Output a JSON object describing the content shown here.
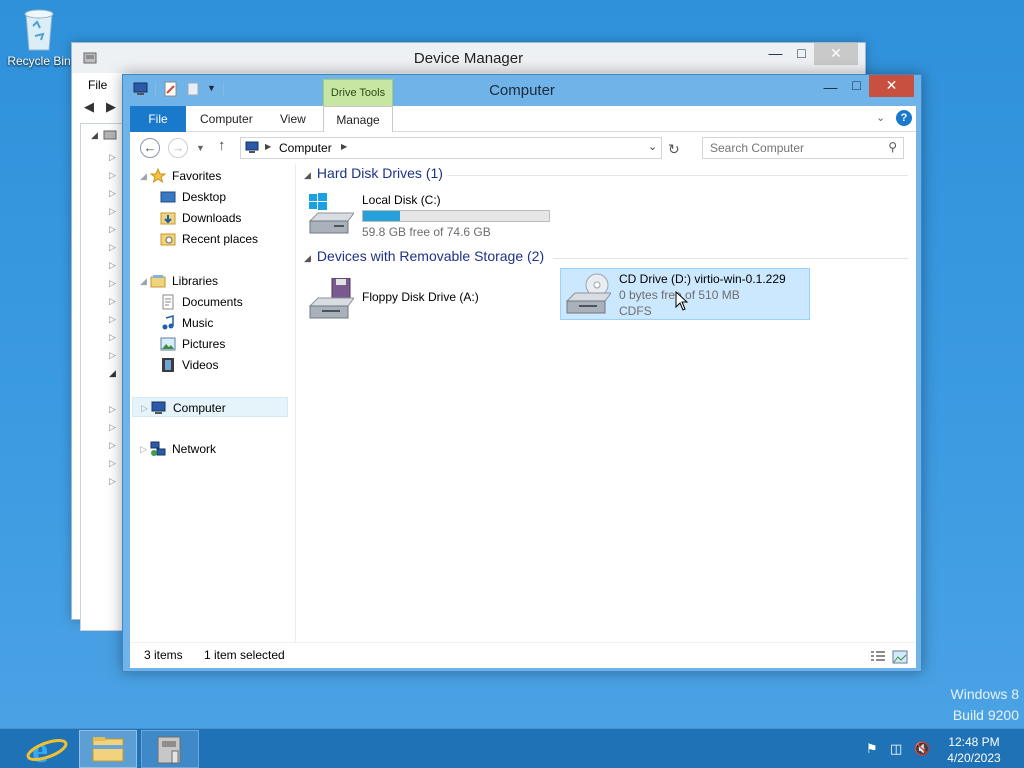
{
  "desktop": {
    "recycle_bin_label": "Recycle Bin",
    "watermark_line1": "Windows 8",
    "watermark_line2": "Build 9200"
  },
  "device_manager": {
    "title": "Device Manager",
    "menu_file": "File"
  },
  "explorer": {
    "title": "Computer",
    "contextual_tab": "Drive Tools",
    "ribbon_tabs": [
      "File",
      "Computer",
      "View",
      "Manage"
    ],
    "address_crumb": "Computer",
    "search_placeholder": "Search Computer",
    "nav": {
      "favorites": "Favorites",
      "desktop": "Desktop",
      "downloads": "Downloads",
      "recent": "Recent places",
      "libraries": "Libraries",
      "documents": "Documents",
      "music": "Music",
      "pictures": "Pictures",
      "videos": "Videos",
      "computer": "Computer",
      "network": "Network"
    },
    "groups": {
      "hdd": "Hard Disk Drives (1)",
      "removable": "Devices with Removable Storage (2)"
    },
    "drives": {
      "c": {
        "name": "Local Disk (C:)",
        "free": "59.8 GB free of 74.6 GB",
        "used_fraction": 0.2
      },
      "a": {
        "name": "Floppy Disk Drive (A:)"
      },
      "d": {
        "name": "CD Drive (D:) virtio-win-0.1.229",
        "free": "0 bytes free of 510 MB",
        "fs": "CDFS"
      }
    },
    "status": {
      "items": "3 items",
      "selected": "1 item selected"
    }
  },
  "taskbar": {
    "time": "12:48 PM",
    "date": "4/20/2023"
  },
  "colors": {
    "accent": "#1979ca",
    "drive_bar": "#26a0da",
    "selection": "#cce8ff",
    "close": "#c7503f",
    "contextual_tab": "#c7e6a1"
  }
}
